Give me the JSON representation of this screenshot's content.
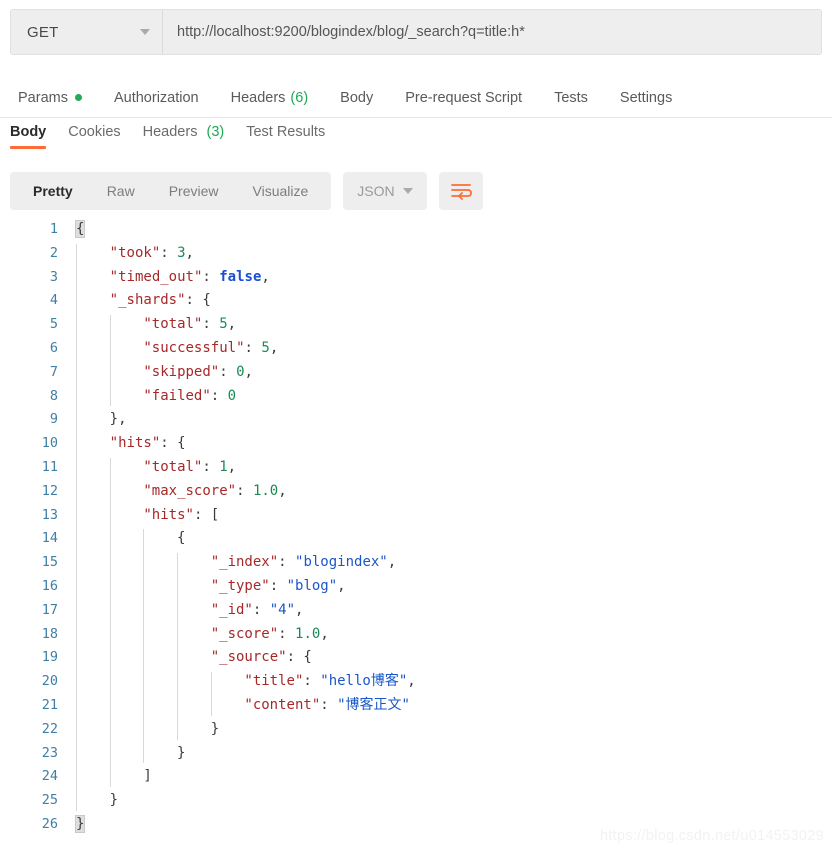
{
  "request_bar": {
    "method": "GET",
    "method_caret_icon": "chevron-down-icon",
    "url": "http://localhost:9200/blogindex/blog/_search?q=title:h*"
  },
  "request_tabs": [
    {
      "label": "Params",
      "has_dot": true
    },
    {
      "label": "Authorization",
      "has_dot": false
    },
    {
      "label": "Headers",
      "count": "(6)"
    },
    {
      "label": "Body",
      "has_dot": false
    },
    {
      "label": "Pre-request Script",
      "has_dot": false
    },
    {
      "label": "Tests",
      "has_dot": false
    },
    {
      "label": "Settings",
      "has_dot": false
    }
  ],
  "response_tabs": [
    {
      "label": "Body",
      "active": true
    },
    {
      "label": "Cookies",
      "active": false
    },
    {
      "label": "Headers",
      "count": "(3)",
      "active": false
    },
    {
      "label": "Test Results",
      "active": false
    }
  ],
  "body_toolbar": {
    "segments": [
      {
        "label": "Pretty",
        "active": true
      },
      {
        "label": "Raw",
        "active": false
      },
      {
        "label": "Preview",
        "active": false
      },
      {
        "label": "Visualize",
        "active": false
      }
    ],
    "format": "JSON",
    "format_caret_icon": "chevron-down-icon",
    "wrap_icon": "text-wrap-icon"
  },
  "colors": {
    "accent_orange": "#ff6c37",
    "green": "#1caa52",
    "key_red": "#a52929",
    "string_blue": "#1a57c8",
    "number_green": "#1a8a54",
    "boolean_blue": "#1a4fcf",
    "line_number_blue": "#3f7fa5",
    "toolbar_gray": "#eeeeee"
  },
  "watermark": "https://blog.csdn.net/u014553029",
  "response_body": {
    "language": "json",
    "line_count": 26,
    "raw": "{\n    \"took\": 3,\n    \"timed_out\": false,\n    \"_shards\": {\n        \"total\": 5,\n        \"successful\": 5,\n        \"skipped\": 0,\n        \"failed\": 0\n    },\n    \"hits\": {\n        \"total\": 1,\n        \"max_score\": 1.0,\n        \"hits\": [\n            {\n                \"_index\": \"blogindex\",\n                \"_type\": \"blog\",\n                \"_id\": \"4\",\n                \"_score\": 1.0,\n                \"_source\": {\n                    \"title\": \"hello博客\",\n                    \"content\": \"博客正文\"\n                }\n            }\n        ]\n    }\n}",
    "parsed": {
      "took": 3,
      "timed_out": false,
      "_shards": {
        "total": 5,
        "successful": 5,
        "skipped": 0,
        "failed": 0
      },
      "hits": {
        "total": 1,
        "max_score": 1.0,
        "hits": [
          {
            "_index": "blogindex",
            "_type": "blog",
            "_id": "4",
            "_score": 1.0,
            "_source": {
              "title": "hello博客",
              "content": "博客正文"
            }
          }
        ]
      }
    },
    "lines": [
      {
        "num": 1,
        "indent": 0,
        "tokens": [
          {
            "t": "{",
            "c": "p",
            "hl": true
          }
        ]
      },
      {
        "num": 2,
        "indent": 1,
        "tokens": [
          {
            "t": "\"took\"",
            "c": "k"
          },
          {
            "t": ": ",
            "c": "p"
          },
          {
            "t": "3",
            "c": "n"
          },
          {
            "t": ",",
            "c": "p"
          }
        ]
      },
      {
        "num": 3,
        "indent": 1,
        "tokens": [
          {
            "t": "\"timed_out\"",
            "c": "k"
          },
          {
            "t": ": ",
            "c": "p"
          },
          {
            "t": "false",
            "c": "b"
          },
          {
            "t": ",",
            "c": "p"
          }
        ]
      },
      {
        "num": 4,
        "indent": 1,
        "tokens": [
          {
            "t": "\"_shards\"",
            "c": "k"
          },
          {
            "t": ": {",
            "c": "p"
          }
        ]
      },
      {
        "num": 5,
        "indent": 2,
        "tokens": [
          {
            "t": "\"total\"",
            "c": "k"
          },
          {
            "t": ": ",
            "c": "p"
          },
          {
            "t": "5",
            "c": "n"
          },
          {
            "t": ",",
            "c": "p"
          }
        ]
      },
      {
        "num": 6,
        "indent": 2,
        "tokens": [
          {
            "t": "\"successful\"",
            "c": "k"
          },
          {
            "t": ": ",
            "c": "p"
          },
          {
            "t": "5",
            "c": "n"
          },
          {
            "t": ",",
            "c": "p"
          }
        ]
      },
      {
        "num": 7,
        "indent": 2,
        "tokens": [
          {
            "t": "\"skipped\"",
            "c": "k"
          },
          {
            "t": ": ",
            "c": "p"
          },
          {
            "t": "0",
            "c": "n"
          },
          {
            "t": ",",
            "c": "p"
          }
        ]
      },
      {
        "num": 8,
        "indent": 2,
        "tokens": [
          {
            "t": "\"failed\"",
            "c": "k"
          },
          {
            "t": ": ",
            "c": "p"
          },
          {
            "t": "0",
            "c": "n"
          }
        ]
      },
      {
        "num": 9,
        "indent": 1,
        "tokens": [
          {
            "t": "},",
            "c": "p"
          }
        ]
      },
      {
        "num": 10,
        "indent": 1,
        "tokens": [
          {
            "t": "\"hits\"",
            "c": "k"
          },
          {
            "t": ": {",
            "c": "p"
          }
        ]
      },
      {
        "num": 11,
        "indent": 2,
        "tokens": [
          {
            "t": "\"total\"",
            "c": "k"
          },
          {
            "t": ": ",
            "c": "p"
          },
          {
            "t": "1",
            "c": "n"
          },
          {
            "t": ",",
            "c": "p"
          }
        ]
      },
      {
        "num": 12,
        "indent": 2,
        "tokens": [
          {
            "t": "\"max_score\"",
            "c": "k"
          },
          {
            "t": ": ",
            "c": "p"
          },
          {
            "t": "1.0",
            "c": "n"
          },
          {
            "t": ",",
            "c": "p"
          }
        ]
      },
      {
        "num": 13,
        "indent": 2,
        "tokens": [
          {
            "t": "\"hits\"",
            "c": "k"
          },
          {
            "t": ": [",
            "c": "p"
          }
        ]
      },
      {
        "num": 14,
        "indent": 3,
        "tokens": [
          {
            "t": "{",
            "c": "p"
          }
        ]
      },
      {
        "num": 15,
        "indent": 4,
        "tokens": [
          {
            "t": "\"_index\"",
            "c": "k"
          },
          {
            "t": ": ",
            "c": "p"
          },
          {
            "t": "\"blogindex\"",
            "c": "s"
          },
          {
            "t": ",",
            "c": "p"
          }
        ]
      },
      {
        "num": 16,
        "indent": 4,
        "tokens": [
          {
            "t": "\"_type\"",
            "c": "k"
          },
          {
            "t": ": ",
            "c": "p"
          },
          {
            "t": "\"blog\"",
            "c": "s"
          },
          {
            "t": ",",
            "c": "p"
          }
        ]
      },
      {
        "num": 17,
        "indent": 4,
        "tokens": [
          {
            "t": "\"_id\"",
            "c": "k"
          },
          {
            "t": ": ",
            "c": "p"
          },
          {
            "t": "\"4\"",
            "c": "s"
          },
          {
            "t": ",",
            "c": "p"
          }
        ]
      },
      {
        "num": 18,
        "indent": 4,
        "tokens": [
          {
            "t": "\"_score\"",
            "c": "k"
          },
          {
            "t": ": ",
            "c": "p"
          },
          {
            "t": "1.0",
            "c": "n"
          },
          {
            "t": ",",
            "c": "p"
          }
        ]
      },
      {
        "num": 19,
        "indent": 4,
        "tokens": [
          {
            "t": "\"_source\"",
            "c": "k"
          },
          {
            "t": ": {",
            "c": "p"
          }
        ]
      },
      {
        "num": 20,
        "indent": 5,
        "tokens": [
          {
            "t": "\"title\"",
            "c": "k"
          },
          {
            "t": ": ",
            "c": "p"
          },
          {
            "t": "\"hello博客\"",
            "c": "s"
          },
          {
            "t": ",",
            "c": "p"
          }
        ]
      },
      {
        "num": 21,
        "indent": 5,
        "tokens": [
          {
            "t": "\"content\"",
            "c": "k"
          },
          {
            "t": ": ",
            "c": "p"
          },
          {
            "t": "\"博客正文\"",
            "c": "s"
          }
        ]
      },
      {
        "num": 22,
        "indent": 4,
        "tokens": [
          {
            "t": "}",
            "c": "p"
          }
        ]
      },
      {
        "num": 23,
        "indent": 3,
        "tokens": [
          {
            "t": "}",
            "c": "p"
          }
        ]
      },
      {
        "num": 24,
        "indent": 2,
        "tokens": [
          {
            "t": "]",
            "c": "p"
          }
        ]
      },
      {
        "num": 25,
        "indent": 1,
        "tokens": [
          {
            "t": "}",
            "c": "p"
          }
        ]
      },
      {
        "num": 26,
        "indent": 0,
        "tokens": [
          {
            "t": "}",
            "c": "p",
            "hl": true
          }
        ]
      }
    ],
    "indent_guides": [
      {
        "level": 1,
        "from_line": 2,
        "to_line": 25
      },
      {
        "level": 2,
        "from_line": 5,
        "to_line": 8
      },
      {
        "level": 2,
        "from_line": 11,
        "to_line": 24
      },
      {
        "level": 3,
        "from_line": 14,
        "to_line": 23
      },
      {
        "level": 4,
        "from_line": 15,
        "to_line": 22
      },
      {
        "level": 5,
        "from_line": 20,
        "to_line": 21
      }
    ]
  }
}
